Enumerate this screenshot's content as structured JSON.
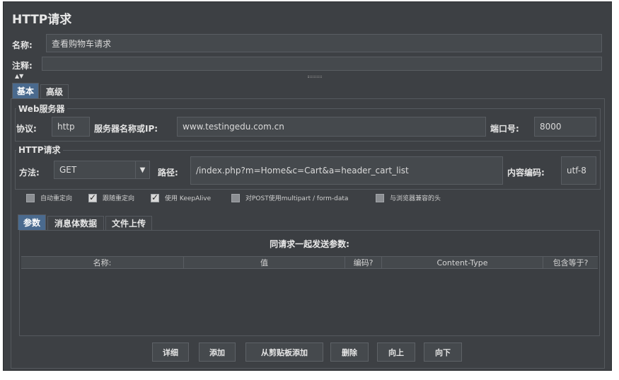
{
  "window": {
    "title": "HTTP请求"
  },
  "header": {
    "name_label": "名称:",
    "name_value": "查看购物车请求",
    "comment_label": "注释:",
    "comment_value": ""
  },
  "tabs": [
    {
      "label": "基本",
      "active": true
    },
    {
      "label": "高级",
      "active": false
    }
  ],
  "web_server": {
    "legend": "Web服务器",
    "protocol_label": "协议:",
    "protocol_value": "http",
    "server_label": "服务器名称或IP:",
    "server_value": "www.testingedu.com.cn",
    "port_label": "端口号:",
    "port_value": "8000"
  },
  "http_request": {
    "legend": "HTTP请求",
    "method_label": "方法:",
    "method_value": "GET",
    "path_label": "路径:",
    "path_value": "/index.php?m=Home&c=Cart&a=header_cart_list",
    "encoding_label": "内容编码:",
    "encoding_value": "utf-8"
  },
  "options": [
    {
      "label": "自动重定向",
      "checked": false
    },
    {
      "label": "跟随重定向",
      "checked": true
    },
    {
      "label": "使用 KeepAlive",
      "checked": true
    },
    {
      "label": "对POST使用multipart / form-data",
      "checked": false
    },
    {
      "label": "与浏览器兼容的头",
      "checked": false
    }
  ],
  "sub_tabs": [
    {
      "label": "参数",
      "active": true
    },
    {
      "label": "消息体数据",
      "active": false
    },
    {
      "label": "文件上传",
      "active": false
    }
  ],
  "params": {
    "title": "同请求一起发送参数:",
    "columns": [
      "名称:",
      "值",
      "编码?",
      "Content-Type",
      "包含等于?"
    ]
  },
  "buttons": {
    "detail": "详细",
    "add": "添加",
    "add_from_clipboard": "从剪贴板添加",
    "delete": "删除",
    "up": "向上",
    "down": "向下"
  },
  "colors": {
    "background": "#3d4044",
    "active_tab": "#4a6a8e",
    "field": "#45494d"
  }
}
